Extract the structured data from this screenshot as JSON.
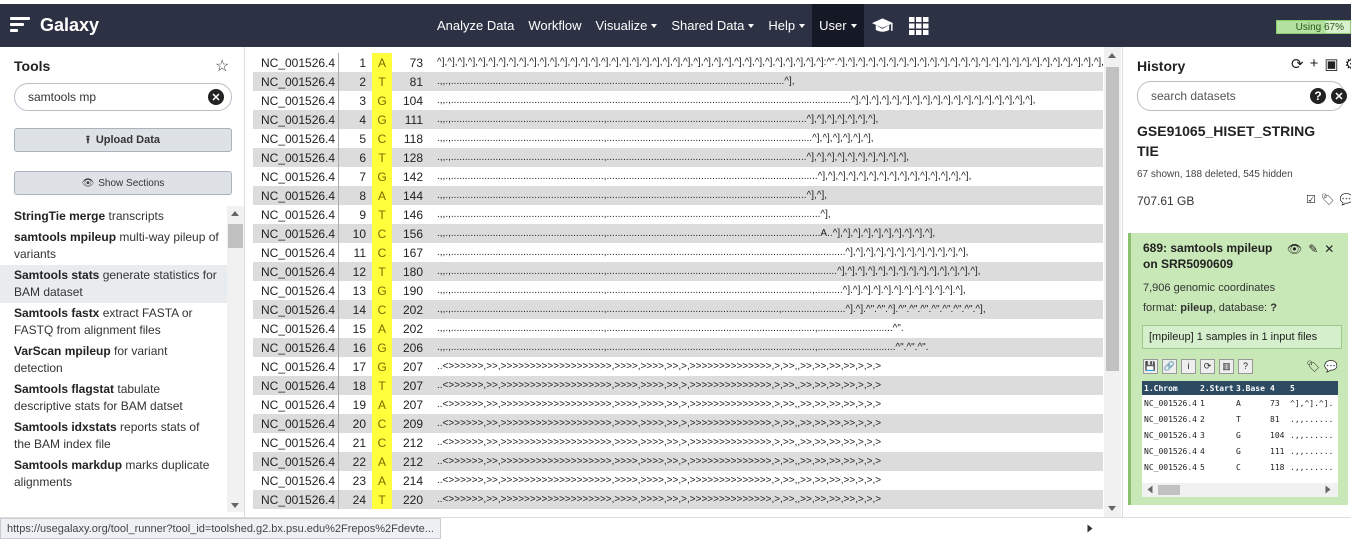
{
  "brand": {
    "name": "Galaxy"
  },
  "nav": {
    "items": [
      "Analyze Data",
      "Workflow",
      "Visualize",
      "Shared Data",
      "Help",
      "User"
    ],
    "quota_label": "Using 67%",
    "quota_fraction": 0.67
  },
  "tools": {
    "title": "Tools",
    "search_value": "samtools mp",
    "upload_label": "Upload Data",
    "sections_label": "Show Sections",
    "items": [
      {
        "name": "StringTie merge",
        "desc": "transcripts"
      },
      {
        "name": "samtools mpileup",
        "desc": "multi-way pileup of variants"
      },
      {
        "name": "Samtools stats",
        "desc": "generate statistics for BAM dataset"
      },
      {
        "name": "Samtools fastx",
        "desc": "extract FASTA or FASTQ from alignment files"
      },
      {
        "name": "VarScan mpileup",
        "desc": "for variant detection"
      },
      {
        "name": "Samtools flagstat",
        "desc": "tabulate descriptive stats for BAM datset"
      },
      {
        "name": "Samtools idxstats",
        "desc": "reports stats of the BAM index file"
      },
      {
        "name": "Samtools markdup",
        "desc": "marks duplicate alignments"
      }
    ]
  },
  "pileup": {
    "rows": [
      {
        "chrom": "NC_001526.4",
        "pos": "1",
        "base": "A",
        "depth": "73",
        "reads": "^],^],^],^],^],^],^],^],^],^],^],^],^],^],^],^],^],^],^],^],^],^],^],^],^],^],^],^],^],^],^],^],^],^],^],^],^],^]:^\".^],^],^],^],^],^],^],^],^],^],^],^],^],^],^],^],^],^],^],^],^],^],^],^],^],^],^],^],^],^],^],^],^]"
      },
      {
        "chrom": "NC_001526.4",
        "pos": "2",
        "base": "T",
        "depth": "81",
        "reads": ".,,.,........................................................................................................................^],"
      },
      {
        "chrom": "NC_001526.4",
        "pos": "3",
        "base": "G",
        "depth": "104",
        "reads": ".,,.,................................................................................................................................................^],^],^],^],^],^],^],^],^],^],^],^],^],^],^],^],^],^],"
      },
      {
        "chrom": "NC_001526.4",
        "pos": "4",
        "base": "G",
        "depth": "111",
        "reads": ".,,.,.......................................................,........................................................................^],^],^],^],^],^],^],"
      },
      {
        "chrom": "NC_001526.4",
        "pos": "5",
        "base": "C",
        "depth": "118",
        "reads": ".,,.,.......................................................,..........................................................................^],^],^],^],^],^],"
      },
      {
        "chrom": "NC_001526.4",
        "pos": "6",
        "base": "T",
        "depth": "128",
        "reads": ".,,.,.......................................................,........................................................................^],^],^],^],^],^],^],^],^],^],"
      },
      {
        "chrom": "NC_001526.4",
        "pos": "7",
        "base": "G",
        "depth": "142",
        "reads": ".,,.,.......................................................,............................................................................^],^],^],^],^],^],^],^],^],^],^],^],^],^],^],"
      },
      {
        "chrom": "NC_001526.4",
        "pos": "8",
        "base": "A",
        "depth": "144",
        "reads": ".,,.,.......................................................,........................................................................^],^],"
      },
      {
        "chrom": "NC_001526.4",
        "pos": "9",
        "base": "T",
        "depth": "146",
        "reads": ".,,.,.......................................................,.............................................................................^],"
      },
      {
        "chrom": "NC_001526.4",
        "pos": "10",
        "base": "C",
        "depth": "156",
        "reads": ".,,.,.......................................................,.............................................................................A..^],^],^],^],^],^],^],^],^],^],"
      },
      {
        "chrom": "NC_001526.4",
        "pos": "11",
        "base": "C",
        "depth": "167",
        "reads": ".,,.,.......................................................,......................................................................................^],^],^],^],^],^],^],^],^],^],^],^],"
      },
      {
        "chrom": "NC_001526.4",
        "pos": "12",
        "base": "T",
        "depth": "180",
        "reads": ".,,.,.......................................................,...................................................................................^],^],^],^],^],^],^],^],^],^],^],^],^],^],"
      },
      {
        "chrom": "NC_001526.4",
        "pos": "13",
        "base": "G",
        "depth": "190",
        "reads": ".,,.,.......................................................,..........................................................................,..........^].^].^].^].^].^].^].^].^].^].^].^],"
      },
      {
        "chrom": "NC_001526.4",
        "pos": "14",
        "base": "C",
        "depth": "202",
        "reads": ".,,.,.......................................................,..............................................................,.......................^].^].^\".^\".^].^\".^\".^\".^\".^\".^\".^\".^],"
      },
      {
        "chrom": "NC_001526.4",
        "pos": "15",
        "base": "A",
        "depth": "202",
        "reads": ".,,.,.......................................................,...........................................................................,...........................^\"."
      },
      {
        "chrom": "NC_001526.4",
        "pos": "16",
        "base": "G",
        "depth": "206",
        "reads": ".,,.,.......................................................,...........................................................................,............................^\".^\".^\"."
      },
      {
        "chrom": "NC_001526.4",
        "pos": "17",
        "base": "G",
        "depth": "207",
        "reads": "..<>>>>>>,>>,>>>>>>>>>>>>>>>>>>>,>>>>,>>>>,>>,>,>>>>>>>>>>>>>>,>,>>,,>>,>>,>>,>>,>,>,>"
      },
      {
        "chrom": "NC_001526.4",
        "pos": "18",
        "base": "T",
        "depth": "207",
        "reads": "..<>>>>>>,>>,>>>>>>>>>>>>>>>>>>>,>>>>,>>>>,>>,>,>>>>>>>>>>>>>>,>,>>,,>>,>>,>>,>>,>,>,>"
      },
      {
        "chrom": "NC_001526.4",
        "pos": "19",
        "base": "A",
        "depth": "207",
        "reads": "..<>>>>>>,>>,>>>>>>>>>>>>>>>>>>>,>>>>,>>>>,>>,>,>>>>>>>>>>>>>>,>,>>,,>>,>>,>>,>>,>,>,>"
      },
      {
        "chrom": "NC_001526.4",
        "pos": "20",
        "base": "C",
        "depth": "209",
        "reads": "..<>>>>>>,>>,>>>>>>>>>>>>>>>>>>>,>>>>,>>>>,>>,>,>>>>>>>>>>>>>>,>,>>,,>>,>>,>>,>>,>,>,>"
      },
      {
        "chrom": "NC_001526.4",
        "pos": "21",
        "base": "C",
        "depth": "212",
        "reads": "..<>>>>>>,>>,>>>>>>>>>>>>>>>>>>>,>>>>,>>>>,>>,>,>>>>>>>>>>>>>>,>,>>,,>>,>>,>>,>>,>,>,>"
      },
      {
        "chrom": "NC_001526.4",
        "pos": "22",
        "base": "A",
        "depth": "212",
        "reads": "..<>>>>>>,>>,>>>>>>>>>>>>>>>>>>>,>>>>,>>>>,>>,>,>>>>>>>>>>>>>>,>,>>,,>>,>>,>>,>>,>,>,>"
      },
      {
        "chrom": "NC_001526.4",
        "pos": "23",
        "base": "A",
        "depth": "214",
        "reads": "..<>>>>>>,>>,>>>>>>>>>>>>>>>>>>>,>>>>,>>>>,>>,>,>>>>>>>>>>>>>>,>,>>,,>>,>>,>>,>>,>,>,>"
      },
      {
        "chrom": "NC_001526.4",
        "pos": "24",
        "base": "T",
        "depth": "220",
        "reads": "..<>>>>>>,>>,>>>>>>>>>>>>>>>>>>>,>>>>,>>>>,>>,>,>>>>>>>>>>>>>>,>,>>,,>>,>>,>>,>>,>,>,>"
      }
    ]
  },
  "history": {
    "title": "History",
    "search_placeholder": "search datasets",
    "name": "GSE91065_HISET_STRINGTIE",
    "shown_text": "67 shown, 188 deleted, 545 hidden",
    "size": "707.61 GB",
    "dataset": {
      "title": "689: samtools mpileup on SRR5090609",
      "coords": "7,906 genomic coordinates",
      "format_label": "format: ",
      "format_value": "pileup",
      "db_label": ", database: ",
      "db_value": "?",
      "info": "[mpileup] 1 samples in 1 input files",
      "peek_headers": [
        "1.Chrom",
        "2.Start",
        "3.Base",
        "4",
        "5"
      ],
      "peek_rows": [
        [
          "NC_001526.4",
          "1",
          "A",
          "73",
          "^],^].^]."
        ],
        [
          "NC_001526.4",
          "2",
          "T",
          "81",
          ".,,......"
        ],
        [
          "NC_001526.4",
          "3",
          "G",
          "104",
          ".,,......"
        ],
        [
          "NC_001526.4",
          "4",
          "G",
          "111",
          ".,,......"
        ],
        [
          "NC_001526.4",
          "5",
          "C",
          "118",
          ".,,......"
        ]
      ]
    }
  },
  "status": {
    "url": "https://usegalaxy.org/tool_runner?tool_id=toolshed.g2.bx.psu.edu%2Frepos%2Fdevte..."
  }
}
